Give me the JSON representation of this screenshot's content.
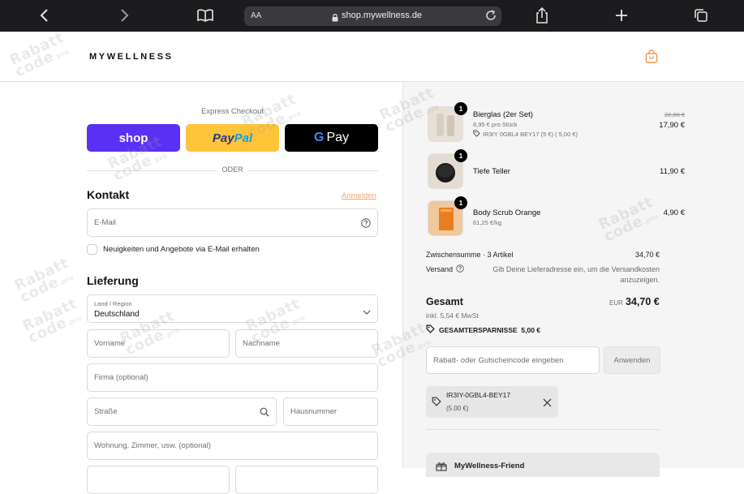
{
  "browser": {
    "text_size_label": "AA",
    "url": "shop.mywellness.de"
  },
  "header": {
    "logo": "MYWELLNESS"
  },
  "express": {
    "label": "Express Checkout",
    "shop_label": "shop",
    "paypal_part1": "Pay",
    "paypal_part2": "Pal",
    "gpay_g": "G",
    "gpay_label": "Pay",
    "divider": "ODER"
  },
  "contact": {
    "title": "Kontakt",
    "login_link": "Anmelden",
    "email_placeholder": "E-Mail",
    "newsletter_label": "Neuigkeiten und Angebote via E-Mail erhalten"
  },
  "delivery": {
    "title": "Lieferung",
    "country_label": "Land / Region",
    "country_value": "Deutschland",
    "first_name_placeholder": "Vorname",
    "last_name_placeholder": "Nachname",
    "company_placeholder": "Firma (optional)",
    "street_placeholder": "Straße",
    "house_number_placeholder": "Hausnummer",
    "apartment_placeholder": "Wohnung, Zimmer, usw. (optional)"
  },
  "cart": {
    "items": [
      {
        "name": "Bierglas (2er Set)",
        "unit_price": "8,95 € pro Stück",
        "discount": "IR3IY 0GBL4 BEY17 (5 €) ( 5,00 €)",
        "old_price": "22,90 €",
        "price": "17,90 €",
        "qty": "1"
      },
      {
        "name": "Tiefe Teller",
        "price": "11,90 €",
        "qty": "1"
      },
      {
        "name": "Body Scrub Orange",
        "unit_price": "61,25 €/kg",
        "price": "4,90 €",
        "qty": "1"
      }
    ],
    "subtotal_label": "Zwischensumme · 3 Artikel",
    "subtotal_value": "34,70 €",
    "shipping_label": "Versand",
    "shipping_note": "Gib Deine Lieferadresse ein, um die Versandkosten anzuzeigen.",
    "total_label": "Gesamt",
    "total_currency": "EUR",
    "total_value": "34,70 €",
    "tax_note": "inkl. 5,54 € MwSt",
    "savings": "GESAMTERSPARNISSE  5,00 €",
    "code_placeholder": "Rabatt- oder Gutscheincode eingeben",
    "apply_label": "Anwenden",
    "applied_code": "IR3IY-0GBL4-BEY17",
    "applied_amount": "(5.00 €)",
    "friend_label": "MyWellness-Friend"
  },
  "watermark": {
    "line1": "Rabatt",
    "line2": "code",
    "suffix": ".pro"
  },
  "colors": {
    "shop_pay": "#5a31f4",
    "paypal": "#ffc439",
    "gpay": "#000000",
    "accent_link": "#f2a36b",
    "bag_icon": "#f29a50"
  }
}
